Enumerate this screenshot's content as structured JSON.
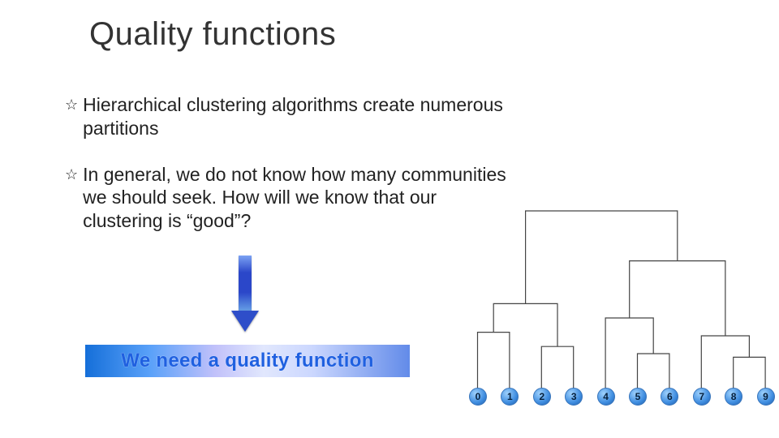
{
  "title": "Quality functions",
  "bullets": [
    "Hierarchical clustering algorithms create numerous partitions",
    "In general, we do not know how many communities we should seek. How will we know that our clustering is “good”?"
  ],
  "callout": "We need a quality function",
  "leaves": [
    "0",
    "1",
    "2",
    "3",
    "4",
    "5",
    "6",
    "7",
    "8",
    "9"
  ],
  "chart_data": {
    "type": "dendrogram",
    "leaves": [
      0,
      1,
      2,
      3,
      4,
      5,
      6,
      7,
      8,
      9
    ],
    "merges": [
      {
        "id": "m01",
        "members": [
          0,
          1
        ],
        "height": 1.6
      },
      {
        "id": "m23",
        "members": [
          2,
          3
        ],
        "height": 1.2
      },
      {
        "id": "m0123",
        "members": [
          0,
          1,
          2,
          3
        ],
        "height": 2.4
      },
      {
        "id": "m56",
        "members": [
          5,
          6
        ],
        "height": 1.0
      },
      {
        "id": "m456",
        "members": [
          4,
          5,
          6
        ],
        "height": 2.0
      },
      {
        "id": "m789",
        "members": [
          7,
          8,
          9
        ],
        "height": 1.5
      },
      {
        "id": "m4to9",
        "members": [
          4,
          5,
          6,
          7,
          8,
          9
        ],
        "height": 3.6
      },
      {
        "id": "root",
        "members": [
          0,
          1,
          2,
          3,
          4,
          5,
          6,
          7,
          8,
          9
        ],
        "height": 5.0
      }
    ],
    "title": "",
    "xlabel": "",
    "ylabel": ""
  }
}
